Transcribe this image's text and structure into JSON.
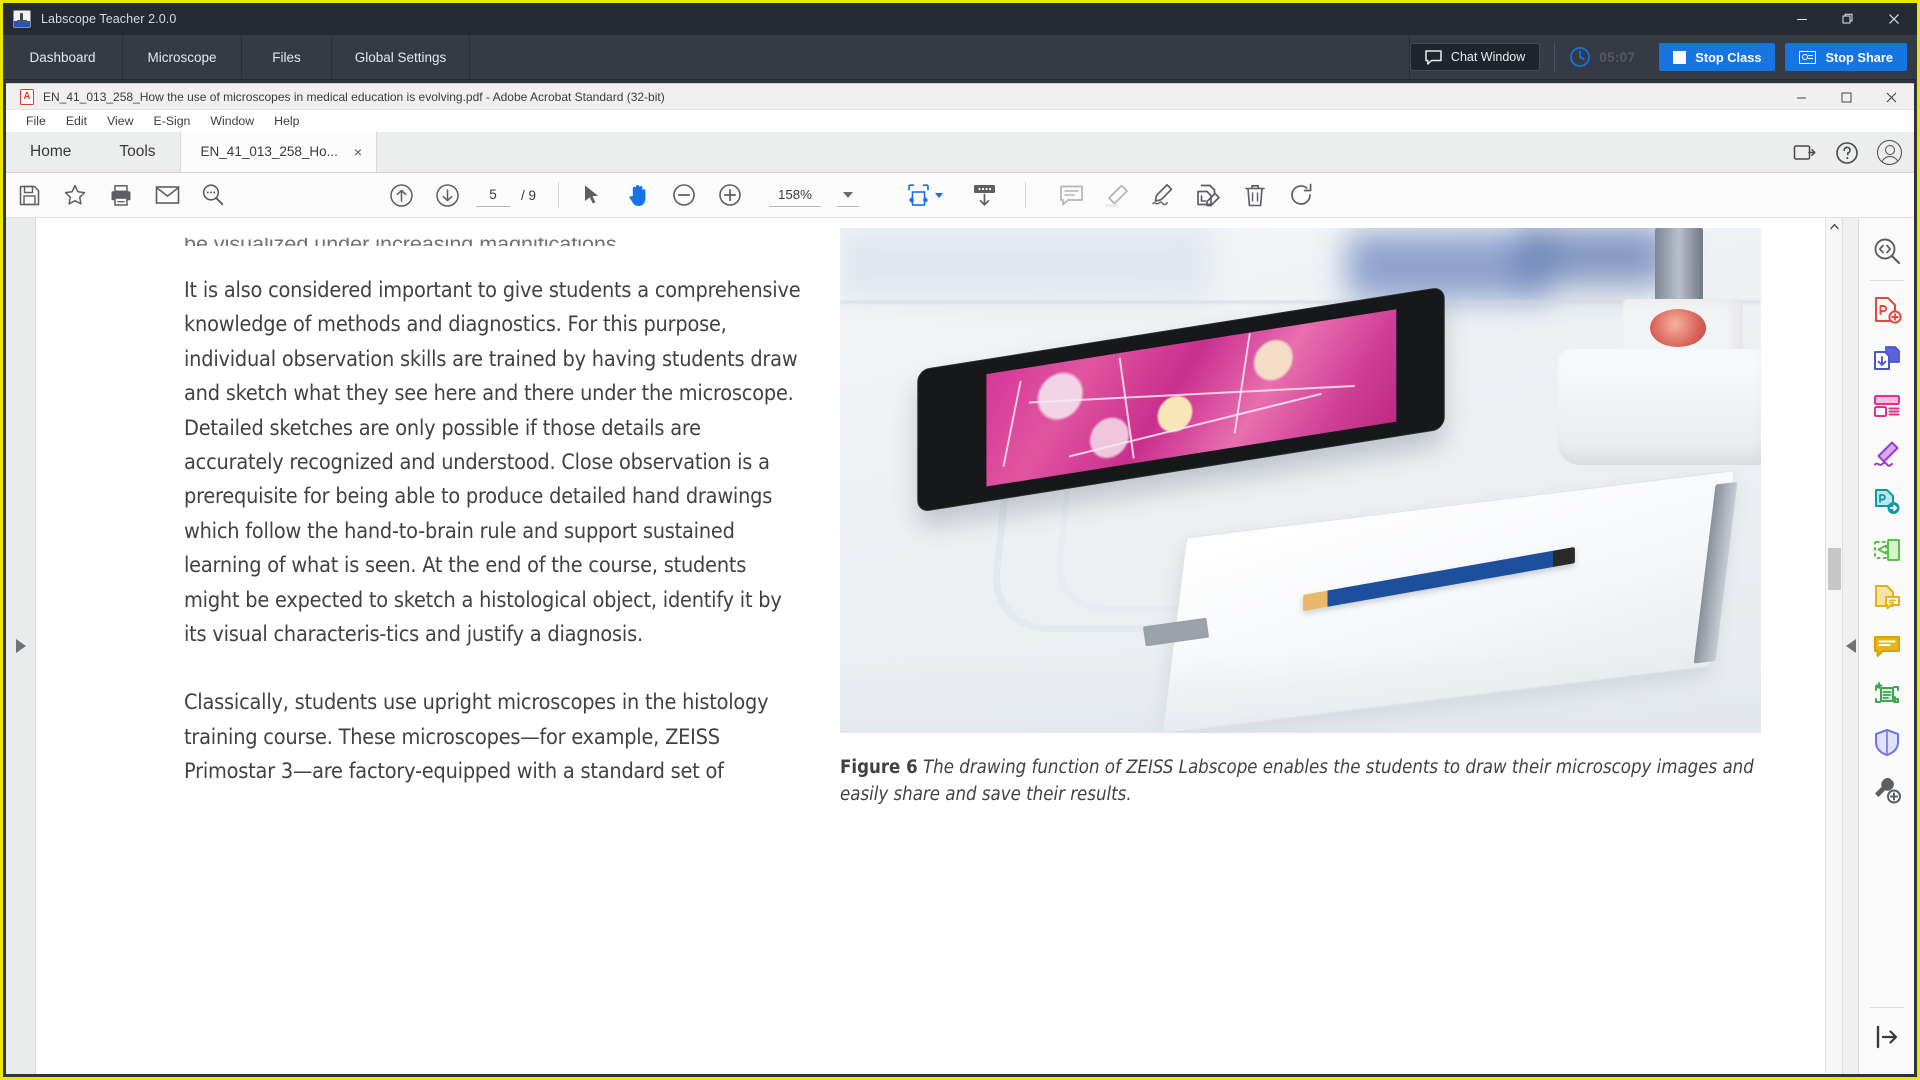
{
  "labscope": {
    "title": "Labscope Teacher 2.0.0",
    "icon": "microscope-app-icon",
    "tabs": [
      {
        "label": "Dashboard",
        "name": "dashboard"
      },
      {
        "label": "Microscope",
        "name": "microscope"
      },
      {
        "label": "Files",
        "name": "files"
      },
      {
        "label": "Global Settings",
        "name": "global-settings"
      }
    ],
    "chat_button": "Chat Window",
    "timer": "05:07",
    "stop_class": "Stop Class",
    "stop_share": "Stop Share",
    "accent_blue": "#1675e0",
    "window_border": "#e8e800",
    "titlebar_bg": "#262a33",
    "nav_bg": "#353a45",
    "window_controls": [
      "minimize",
      "restore",
      "close"
    ]
  },
  "acrobat": {
    "title": "EN_41_013_258_How the use of microscopes in medical education is evolving.pdf - Adobe Acrobat Standard (32-bit)",
    "menus": [
      "File",
      "Edit",
      "View",
      "E-Sign",
      "Window",
      "Help"
    ],
    "tabs": {
      "home": "Home",
      "tools": "Tools",
      "document": "EN_41_013_258_Ho...",
      "close_glyph": "×"
    },
    "toolbar": {
      "page_current": "5",
      "page_total": "/ 9",
      "zoom_level": "158%",
      "active_tool": "hand-tool",
      "icons_left": [
        "save-icon",
        "star-icon",
        "print-icon",
        "email-icon",
        "search-icon"
      ],
      "icons_nav": [
        "previous-page-icon",
        "next-page-icon"
      ],
      "icons_tools": [
        "select-tool-icon",
        "hand-tool-icon",
        "zoom-out-icon",
        "zoom-in-icon"
      ],
      "icons_right": [
        "fit-page-icon",
        "scroll-mode-icon",
        "comment-icon",
        "highlight-icon",
        "sign-icon",
        "stamp-icon",
        "delete-icon",
        "rotate-icon"
      ]
    },
    "tools_rail": [
      {
        "name": "search-text-icon",
        "color": "#5a5f63"
      },
      {
        "name": "create-pdf-icon",
        "color": "#e8453c"
      },
      {
        "name": "combine-files-icon",
        "color": "#4a55d6"
      },
      {
        "name": "organize-pages-icon",
        "color": "#e0308a"
      },
      {
        "name": "fill-and-sign-icon",
        "color": "#9b3cc4"
      },
      {
        "name": "export-pdf-icon",
        "color": "#0d9aa8"
      },
      {
        "name": "compare-files-icon",
        "color": "#5bbf4a"
      },
      {
        "name": "comment-tool-icon",
        "color": "#e3b210"
      },
      {
        "name": "add-comment-icon",
        "color": "#d4a509"
      },
      {
        "name": "enhance-scans-icon",
        "color": "#3fa352"
      },
      {
        "name": "protect-icon",
        "color": "#6f74e8"
      },
      {
        "name": "more-tools-icon",
        "color": "#5a5f63"
      },
      {
        "name": "expand-panel-icon",
        "color": "#3a3a3a"
      }
    ]
  },
  "document": {
    "clipped_line": "be visualized under increasing magnifications.",
    "paragraph_1": "It is also considered important to give students a comprehensive knowledge of methods and diagnostics. For this purpose, individual observation skills are trained by having students draw and sketch what they see here and there under the microscope. Detailed sketches are only possible if those details are accurately recognized and understood. Close observation is a prerequisite for being able to produce detailed hand drawings which follow the hand-to-brain rule and support sustained learning of what is seen. At the end of the course, students might be expected to sketch a histological object, identify it by its visual characteris-tics and justify a diagnosis.",
    "paragraph_2": "Classically, students use upright microscopes in the histology training course. These microscopes—for example, ZEISS Primostar 3—are factory-equipped with a standard set of",
    "figure": {
      "label": "Figure 6",
      "caption": "The drawing function of ZEISS Labscope enables the students to draw their microscopy images and easily share and save their results.",
      "alt": "Tablet on transparent acrylic stand displaying a pink histology micrograph above a white drawing pad with a blue pencil"
    }
  }
}
